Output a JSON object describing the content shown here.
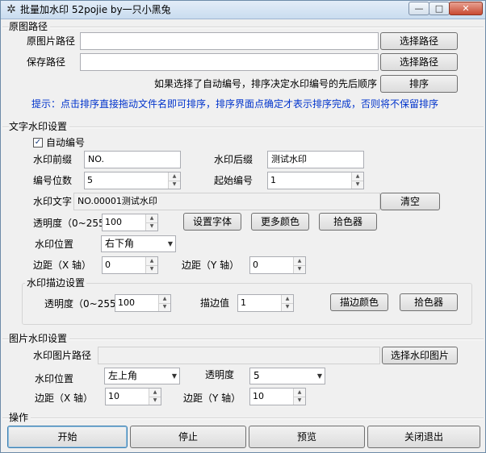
{
  "window": {
    "title": "批量加水印 52pojie by一只小黑兔",
    "app_icon": "gear-icon",
    "controls": {
      "minimize": "—",
      "maximize": "□",
      "close": "✕"
    }
  },
  "source": {
    "section": "原图路径",
    "orig_label": "原图片路径",
    "orig_value": "",
    "save_label": "保存路径",
    "save_value": "",
    "select_btn": "选择路径",
    "sort_note": "如果选择了自动编号，排序决定水印编号的先后顺序",
    "sort_btn": "排序",
    "hint": "提示：点击排序直接拖动文件名即可排序，排序界面点确定才表示排序完成，否则将不保留排序"
  },
  "text_wm": {
    "section": "文字水印设置",
    "auto_number_label": "自动编号",
    "auto_number_checked": true,
    "check_mark": "✓",
    "prefix_label": "水印前缀",
    "prefix_value": "NO.",
    "suffix_label": "水印后缀",
    "suffix_value": "测试水印",
    "digits_label": "编号位数",
    "digits_value": "5",
    "start_label": "起始编号",
    "start_value": "1",
    "text_label": "水印文字",
    "text_value": "NO.00001测试水印",
    "clear_btn": "清空",
    "opacity_label": "透明度（0~255）",
    "opacity_value": "100",
    "font_btn": "设置字体",
    "more_color_btn": "更多颜色",
    "picker_btn": "拾色器",
    "position_label": "水印位置",
    "position_value": "右下角",
    "margin_x_label": "边距（X 轴）",
    "margin_x_value": "0",
    "margin_y_label": "边距（Y 轴）",
    "margin_y_value": "0"
  },
  "stroke": {
    "section": "水印描边设置",
    "opacity_label": "透明度（0~255）",
    "opacity_value": "100",
    "stroke_label": "描边值",
    "stroke_value": "1",
    "color_btn": "描边颜色",
    "picker_btn": "拾色器"
  },
  "image_wm": {
    "section": "图片水印设置",
    "path_label": "水印图片路径",
    "path_value": "",
    "select_btn": "选择水印图片",
    "position_label": "水印位置",
    "position_value": "左上角",
    "opacity_label": "透明度",
    "opacity_value": "5",
    "margin_x_label": "边距（X 轴）",
    "margin_x_value": "10",
    "margin_y_label": "边距（Y 轴）",
    "margin_y_value": "10"
  },
  "actions": {
    "section": "操作",
    "start": "开始",
    "stop": "停止",
    "preview": "预览",
    "exit": "关闭退出"
  },
  "icons": {
    "spin_up": "▲",
    "spin_down": "▼",
    "dropdown": "▼"
  }
}
